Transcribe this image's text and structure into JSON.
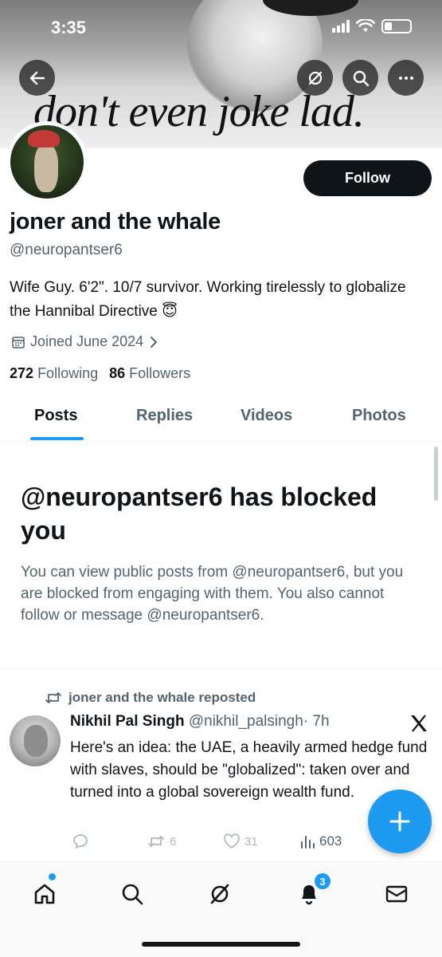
{
  "status_bar": {
    "time": "3:35"
  },
  "banner": {
    "text": "don't even joke lad."
  },
  "header_buttons": {
    "back_icon": "arrow-left-icon",
    "grok_icon": "grok-icon",
    "search_icon": "search-icon",
    "more_icon": "more-horizontal-icon"
  },
  "profile": {
    "follow_label": "Follow",
    "name": "joner and the whale",
    "handle": "@neuropantser6",
    "bio": "Wife Guy. 6'2\". 10/7 survivor. Working tirelessly to globalize the Hannibal Directive 😇",
    "joined": "Joined June 2024",
    "following_count": "272",
    "following_label": "Following",
    "followers_count": "86",
    "followers_label": "Followers"
  },
  "tabs": [
    {
      "label": "Posts",
      "active": true
    },
    {
      "label": "Replies",
      "active": false
    },
    {
      "label": "Videos",
      "active": false
    },
    {
      "label": "Photos",
      "active": false
    }
  ],
  "blocked": {
    "title": "@neuropantser6 has blocked you",
    "message": "You can view public posts from @neuropantser6, but you are blocked from engaging with them. You also cannot follow or message @neuropantser6."
  },
  "post": {
    "repost_label": "joner and the whale reposted",
    "author_name": "Nikhil Pal Singh",
    "author_handle": "@nikhil_palsingh",
    "time": "· 7h",
    "text": "Here's an idea: the UAE, a heavily armed hedge fund with slaves, should be \"globalized\": taken over and turned into a global sovereign wealth fund.",
    "replies": "",
    "reposts": "6",
    "likes": "31",
    "views": "603"
  },
  "bottom_nav": {
    "notifications_badge": "3"
  },
  "colors": {
    "accent": "#1d9bf0",
    "text_primary": "#0f1419",
    "text_secondary": "#536471"
  }
}
